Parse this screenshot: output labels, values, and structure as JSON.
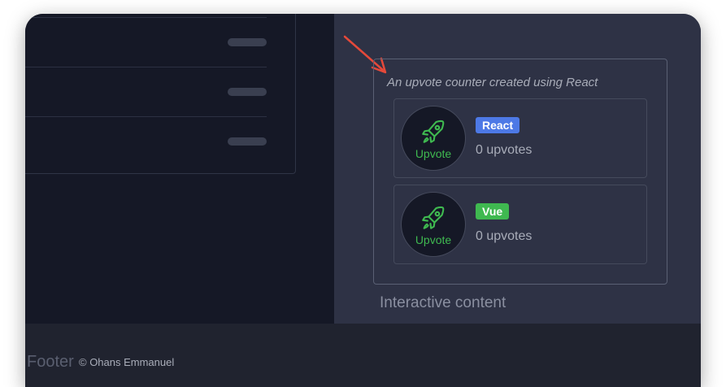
{
  "demo": {
    "caption": "An upvote counter created using React",
    "counters": [
      {
        "button_label": "Upvote",
        "tag": "React",
        "count_text": "0 upvotes",
        "tag_color": "#4d79e6"
      },
      {
        "button_label": "Upvote",
        "tag": "Vue",
        "count_text": "0 upvotes",
        "tag_color": "#3fb950"
      }
    ],
    "icon": "rocket-icon",
    "accent_color": "#3fb950"
  },
  "section": {
    "title": "Interactive content"
  },
  "footer": {
    "title": "Footer",
    "copyright": "© Ohans Emmanuel"
  },
  "annotation": {
    "arrow_color": "#e5493a"
  }
}
